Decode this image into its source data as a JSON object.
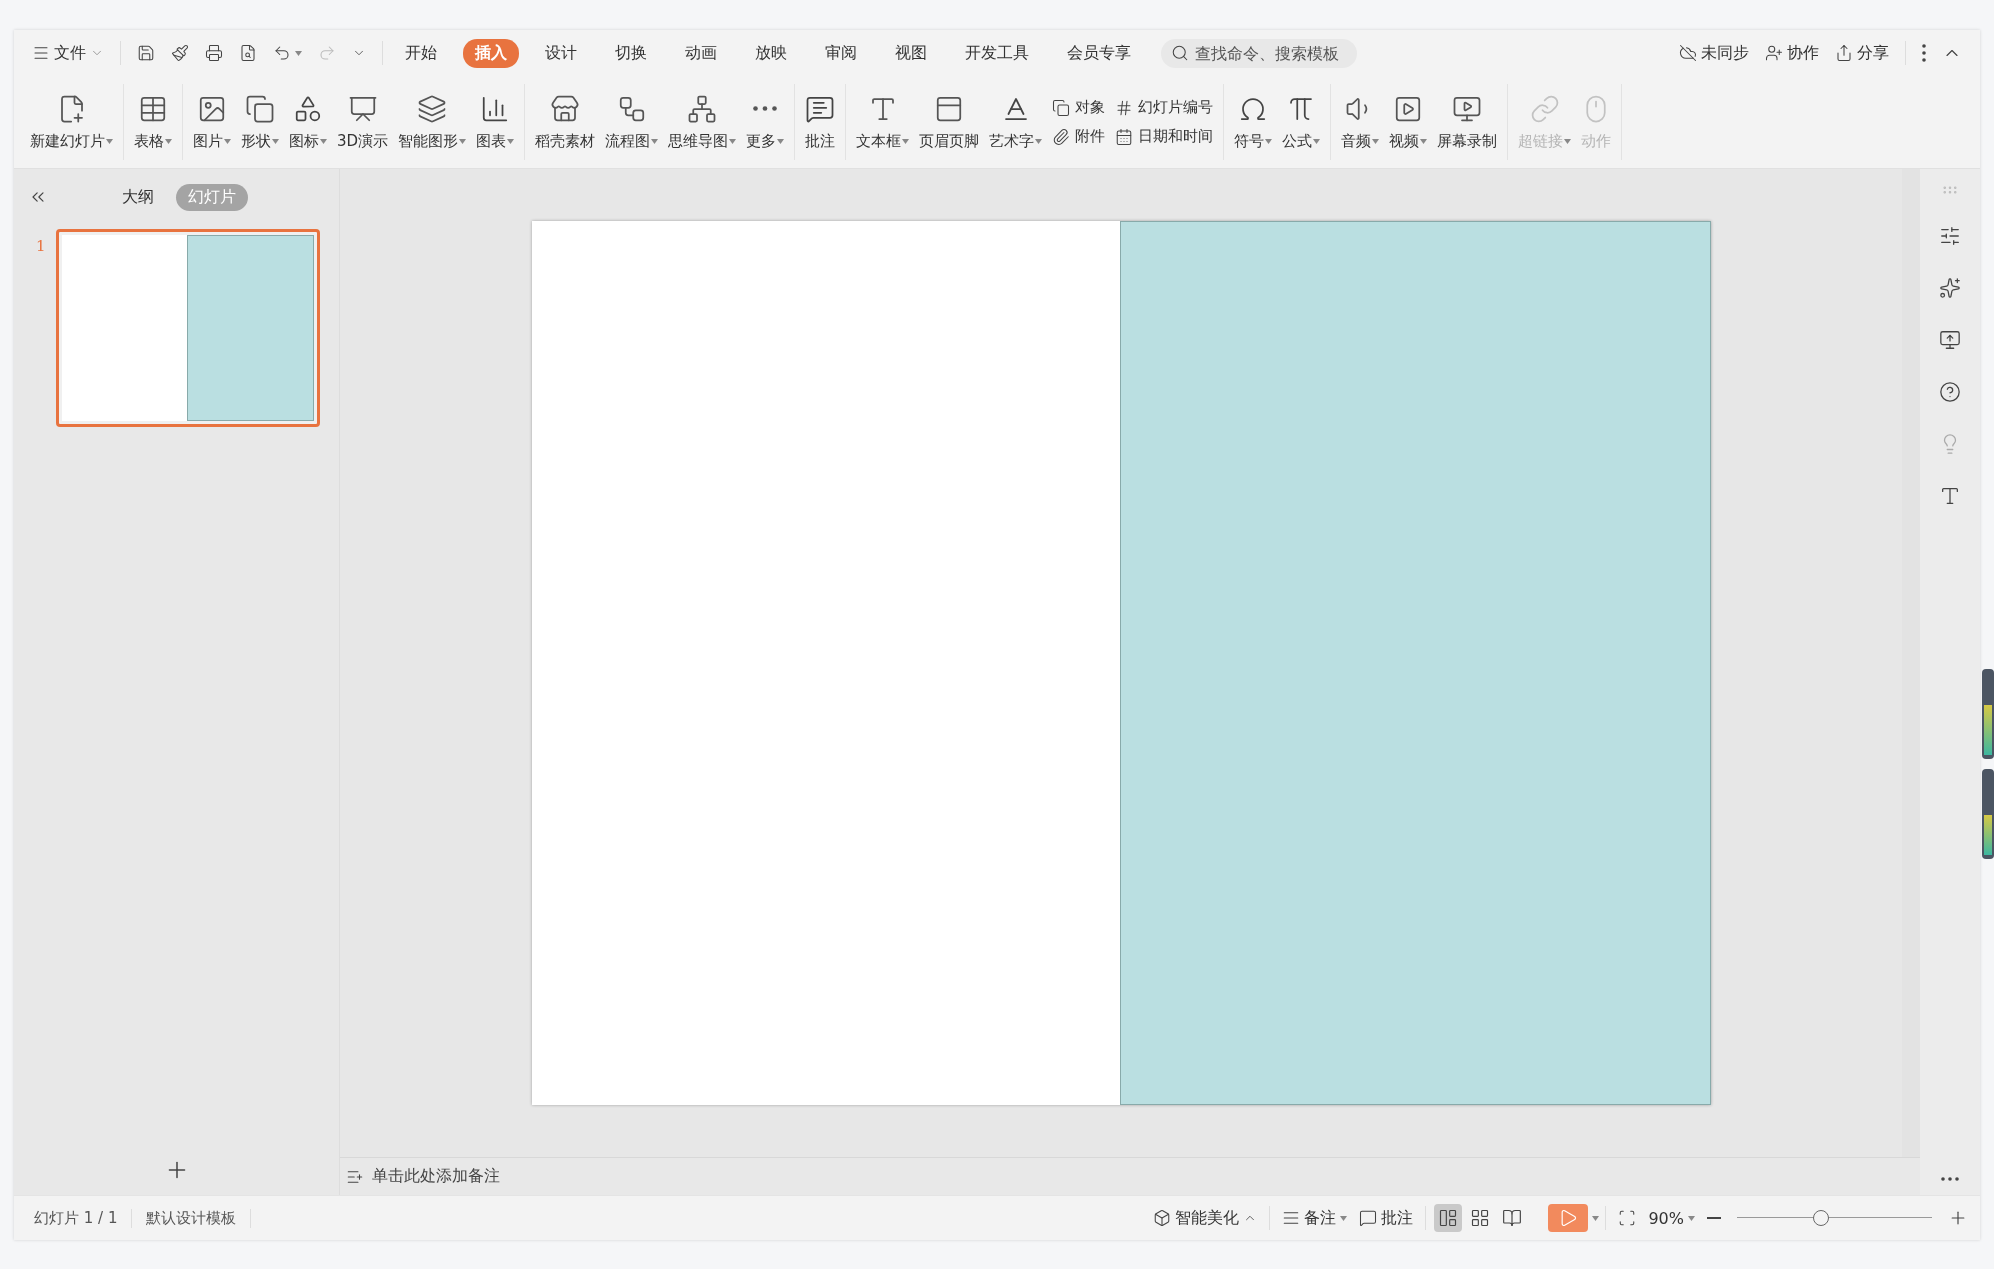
{
  "menubar": {
    "file_menu": "文件",
    "tabs": [
      {
        "label": "开始",
        "selected": false
      },
      {
        "label": "插入",
        "selected": true
      },
      {
        "label": "设计",
        "selected": false
      },
      {
        "label": "切换",
        "selected": false
      },
      {
        "label": "动画",
        "selected": false
      },
      {
        "label": "放映",
        "selected": false
      },
      {
        "label": "审阅",
        "selected": false
      },
      {
        "label": "视图",
        "selected": false
      },
      {
        "label": "开发工具",
        "selected": false
      },
      {
        "label": "会员专享",
        "selected": false
      }
    ],
    "search": {
      "placeholder": "查找命令、搜索模板"
    },
    "actions": [
      "未同步",
      "协作",
      "分享"
    ]
  },
  "ribbon": {
    "groups": [
      {
        "items": [
          {
            "kind": "large",
            "label": "新建幻灯片",
            "dropdown": true,
            "disabled": false
          }
        ]
      },
      {
        "items": [
          {
            "kind": "large",
            "label": "表格",
            "dropdown": true,
            "disabled": false
          }
        ]
      },
      {
        "items": [
          {
            "kind": "large",
            "label": "图片",
            "dropdown": true,
            "disabled": false
          },
          {
            "kind": "large",
            "label": "形状",
            "dropdown": true,
            "disabled": false
          },
          {
            "kind": "large",
            "label": "图标",
            "dropdown": true,
            "disabled": false
          },
          {
            "kind": "large",
            "label": "3D演示",
            "dropdown": false,
            "disabled": false
          },
          {
            "kind": "large",
            "label": "智能图形",
            "dropdown": true,
            "disabled": false
          },
          {
            "kind": "large",
            "label": "图表",
            "dropdown": true,
            "disabled": false
          }
        ]
      },
      {
        "items": [
          {
            "kind": "large",
            "label": "稻壳素材",
            "dropdown": false,
            "disabled": false
          },
          {
            "kind": "large",
            "label": "流程图",
            "dropdown": true,
            "disabled": false
          },
          {
            "kind": "large",
            "label": "思维导图",
            "dropdown": true,
            "disabled": false
          },
          {
            "kind": "large",
            "label": "更多",
            "dropdown": true,
            "disabled": false
          }
        ]
      },
      {
        "items": [
          {
            "kind": "large",
            "label": "批注",
            "dropdown": false,
            "disabled": false
          }
        ]
      },
      {
        "items": [
          {
            "kind": "large",
            "label": "文本框",
            "dropdown": true,
            "disabled": false
          },
          {
            "kind": "large",
            "label": "页眉页脚",
            "dropdown": false,
            "disabled": false
          },
          {
            "kind": "large",
            "label": "艺术字",
            "dropdown": true,
            "disabled": false
          },
          {
            "kind": "stack",
            "labels": [
              "对象",
              "附件"
            ]
          },
          {
            "kind": "stack",
            "labels": [
              "幻灯片编号",
              "日期和时间"
            ]
          }
        ]
      },
      {
        "items": [
          {
            "kind": "large",
            "label": "符号",
            "dropdown": true,
            "disabled": false
          },
          {
            "kind": "large",
            "label": "公式",
            "dropdown": true,
            "disabled": false
          }
        ]
      },
      {
        "items": [
          {
            "kind": "large",
            "label": "音频",
            "dropdown": true,
            "disabled": false
          },
          {
            "kind": "large",
            "label": "视频",
            "dropdown": true,
            "disabled": false
          },
          {
            "kind": "large",
            "label": "屏幕录制",
            "dropdown": false,
            "disabled": false
          }
        ]
      },
      {
        "items": [
          {
            "kind": "large",
            "label": "超链接",
            "dropdown": true,
            "disabled": true
          },
          {
            "kind": "large",
            "label": "动作",
            "dropdown": false,
            "disabled": true
          }
        ]
      }
    ]
  },
  "slide_panel": {
    "view_tabs": [
      {
        "label": "大纲",
        "selected": false
      },
      {
        "label": "幻灯片",
        "selected": true
      }
    ],
    "slides": [
      {
        "number": "1",
        "selected": true
      }
    ]
  },
  "slide": {
    "shapes": [
      {
        "kind": "rectangle",
        "color": "#badfe1"
      }
    ]
  },
  "notes": {
    "prompt": "单击此处添加备注"
  },
  "status_bar": {
    "info": [
      "幻灯片 1 / 1",
      "默认设计模板"
    ],
    "beautify": "智能美化",
    "notes": "备注",
    "comments": "批注",
    "views": [
      {
        "selected": true
      },
      {
        "selected": false
      },
      {
        "selected": false
      }
    ],
    "zoom": "90%",
    "zoom_slider": {
      "level": 0.43
    }
  }
}
